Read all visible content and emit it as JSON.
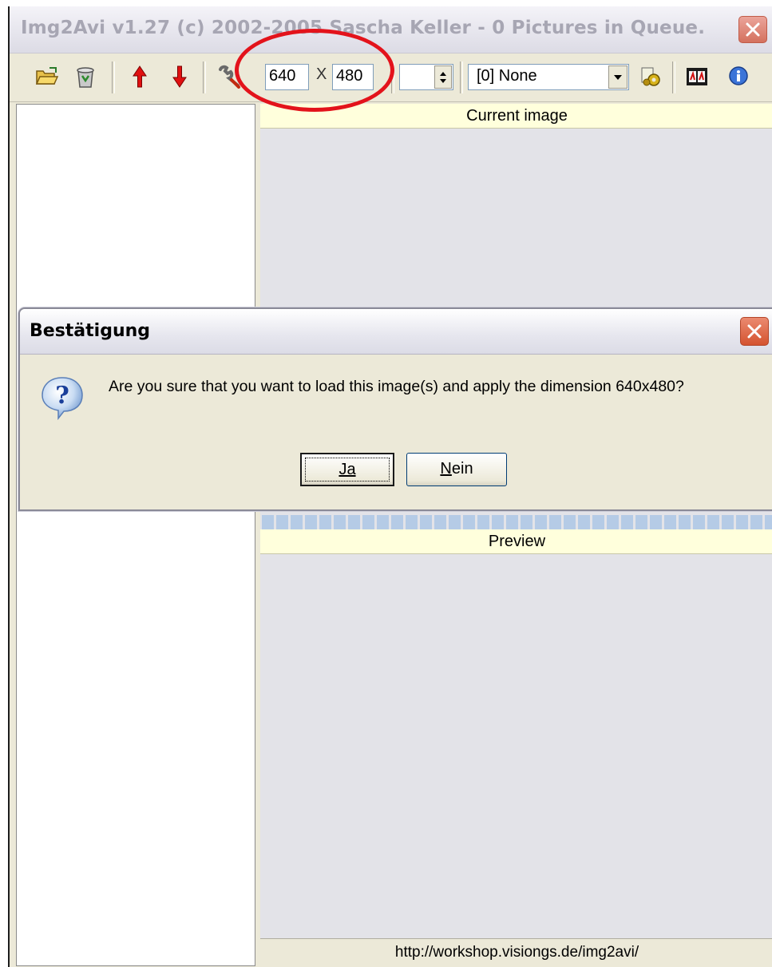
{
  "window": {
    "title": "Img2Avi v1.27 (c) 2002-2005 Sascha Keller - 0 Pictures in Queue."
  },
  "toolbar": {
    "width_value": "640",
    "times_symbol": "X",
    "height_value": "480",
    "selected_option": "[0] None",
    "icons": [
      "open-folder-icon",
      "recycle-bin-icon",
      "move-up-arrow-icon",
      "move-down-arrow-icon",
      "wrench-icon",
      "settings-gears-icon",
      "film-reel-icon",
      "info-icon"
    ]
  },
  "panels": {
    "current_image_label": "Current image",
    "preview_label": "Preview",
    "status_url": "http://workshop.visiongs.de/img2avi/"
  },
  "dialog": {
    "title": "Bestätigung",
    "message": "Are you sure that you want to load this image(s) and apply the dimension 640x480?",
    "yes_label": "Ja",
    "no_label": "Nein",
    "icon": "question-icon"
  },
  "colors": {
    "annotation_circle": "#e3131b",
    "panel_header_bg": "#ffffdc",
    "progress_blue": "#b5cbe6"
  }
}
